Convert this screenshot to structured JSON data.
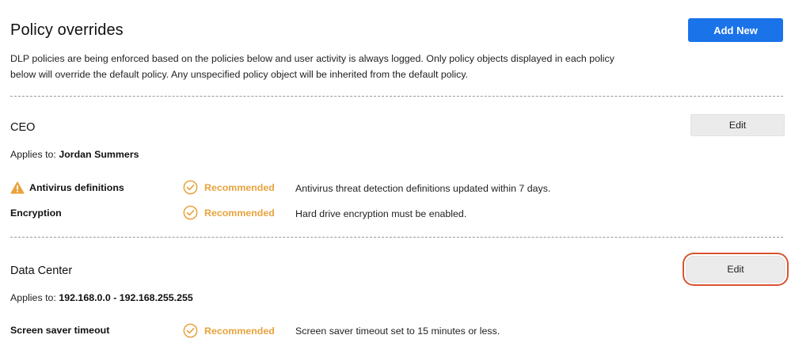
{
  "header": {
    "title": "Policy overrides",
    "add_new_label": "Add New",
    "description": "DLP policies are being enforced based on the policies below and user activity is always logged. Only policy objects displayed in each policy below will override the default policy. Any unspecified policy object will be inherited from the default policy."
  },
  "policies": [
    {
      "name": "CEO",
      "edit_label": "Edit",
      "applies_prefix": "Applies to:",
      "applies_value": "Jordan Summers",
      "rows": [
        {
          "label": "Antivirus definitions",
          "warning_icon": "warning-triangle-icon",
          "status": "Recommended",
          "description": "Antivirus threat detection definitions updated within 7 days."
        },
        {
          "label": "Encryption",
          "status": "Recommended",
          "description": "Hard drive encryption must be enabled."
        }
      ]
    },
    {
      "name": "Data Center",
      "edit_label": "Edit",
      "applies_prefix": "Applies to:",
      "applies_value": "192.168.0.0 - 192.168.255.255",
      "rows": [
        {
          "label": "Screen saver timeout",
          "status": "Recommended",
          "description": "Screen saver timeout set to 15 minutes or less."
        }
      ]
    }
  ],
  "colors": {
    "primary": "#1a73e8",
    "recommended": "#e8a33d",
    "warning": "#e8a33d",
    "highlight_ring": "#d9532f"
  },
  "icons": {
    "status": "check-circle-icon",
    "warning": "warning-triangle-icon"
  }
}
